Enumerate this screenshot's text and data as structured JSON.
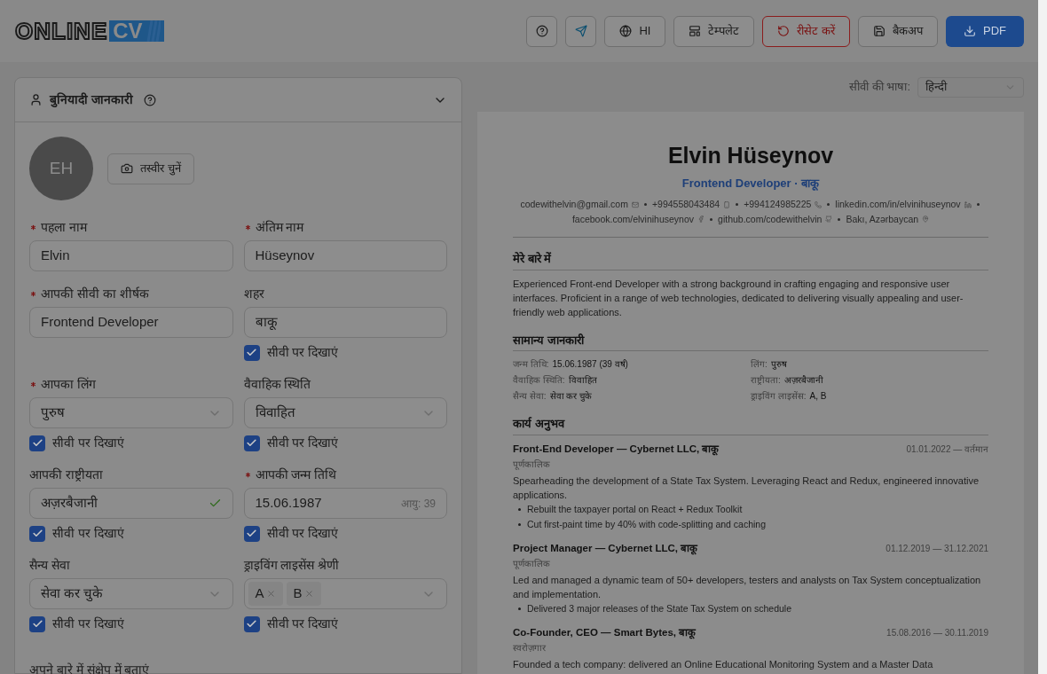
{
  "logo": {
    "word": "ONLINE",
    "mark": "CV"
  },
  "toolbar": [
    {
      "kind": "icon"
    },
    {
      "kind": "icon"
    },
    {
      "kind": "labeled",
      "label": "HI"
    },
    {
      "kind": "labeled",
      "label": "टेम्पलेट"
    },
    {
      "kind": "danger",
      "label": "रीसेट करें"
    },
    {
      "kind": "labeled",
      "label": "बैकअप"
    },
    {
      "kind": "primary",
      "label": "PDF"
    }
  ],
  "section": {
    "title": "बुनियादी जानकारी",
    "expanded": true
  },
  "avatar": {
    "initials": "EH",
    "button": "तस्वीर चुनें"
  },
  "fields": [
    {
      "kind": "input",
      "label": "पहला नाम",
      "required": true,
      "value": "Elvin"
    },
    {
      "kind": "input",
      "label": "अंतिम नाम",
      "required": true,
      "value": "Hüseynov"
    },
    {
      "kind": "input",
      "label": "आपकी सीवी का शीर्षक",
      "required": true,
      "value": "Frontend Developer"
    },
    {
      "kind": "input",
      "label": "शहर",
      "required": false,
      "value": "बाकू",
      "show": {
        "label": "सीवी पर दिखाएं",
        "checked": true
      }
    },
    {
      "kind": "select",
      "label": "आपका लिंग",
      "required": true,
      "value": "पुरुष",
      "show": {
        "label": "सीवी पर दिखाएं",
        "checked": true
      }
    },
    {
      "kind": "select",
      "label": "वैवाहिक स्थिति",
      "required": false,
      "value": "विवाहित",
      "show": {
        "label": "सीवी पर दिखाएं",
        "checked": true
      }
    },
    {
      "kind": "valid",
      "label": "आपकी राष्ट्रीयता",
      "required": false,
      "value": "अज़रबैजानी",
      "show": {
        "label": "सीवी पर दिखाएं",
        "checked": true
      }
    },
    {
      "kind": "date",
      "label": "आपकी जन्म तिथि",
      "required": true,
      "value": "15.06.1987",
      "hint": "आयु: 39",
      "show": {
        "label": "सीवी पर दिखाएं",
        "checked": true
      }
    },
    {
      "kind": "select",
      "label": "सैन्य सेवा",
      "required": false,
      "value": "सेवा कर चुके",
      "show": {
        "label": "सीवी पर दिखाएं",
        "checked": true
      }
    },
    {
      "kind": "multi",
      "label": "ड्राइविंग लाइसेंस श्रेणी",
      "required": false,
      "tags": [
        "A",
        "B"
      ],
      "show": {
        "label": "सीवी पर दिखाएं",
        "checked": true
      }
    }
  ],
  "about_label": "अपने बारे में संक्षेप में बताएं",
  "cv_language": {
    "label": "सीवी की भाषा:",
    "value": "हिन्दी"
  },
  "cv": {
    "name": "Elvin Hüseynov",
    "headline": "Frontend Developer · बाकू",
    "contacts": [
      "codewithelvin@gmail.com",
      "+994558043484",
      "+994124985225",
      "linkedin.com/in/elvinihuseynov",
      "facebook.com/elvinihuseynov",
      "github.com/codewithelvin",
      "Bakı, Azərbaycan"
    ],
    "about_title": "मेरे बारे में",
    "about": "Experienced Front-end Developer with a strong background in crafting engaging and responsive user interfaces. Proficient in a range of web technologies, dedicated to delivering visually appealing and user-friendly web applications.",
    "general_title": "सामान्य जानकारी",
    "general": [
      {
        "label": "जन्म तिथि:",
        "value": "15.06.1987 (39 वर्ष)"
      },
      {
        "label": "लिंग:",
        "value": "पुरुष"
      },
      {
        "label": "वैवाहिक स्थिति:",
        "value": "विवाहित"
      },
      {
        "label": "राष्ट्रीयता:",
        "value": "अज़रबैजानी"
      },
      {
        "label": "सैन्य सेवा:",
        "value": "सेवा कर चुके"
      },
      {
        "label": "ड्राइविंग लाइसेंस:",
        "value": "A, B"
      }
    ],
    "work_title": "कार्य अनुभव",
    "jobs": [
      {
        "title": "Front-End Developer — Cybernet LLC, बाकू",
        "dates": "01.01.2022 — वर्तमान",
        "type": "पूर्णकालिक",
        "summary": "Spearheading the development of a State Tax System. Leveraging React and Redux, engineered innovative applications.",
        "bullets": [
          "Rebuilt the taxpayer portal on React + Redux Toolkit",
          "Cut first-paint time by 40% with code-splitting and caching"
        ]
      },
      {
        "title": "Project Manager — Cybernet LLC, बाकू",
        "dates": "01.12.2019 — 31.12.2021",
        "type": "पूर्णकालिक",
        "summary": "Led and managed a dynamic team of 50+ developers, testers and analysts on Tax System conceptualization and implementation.",
        "bullets": [
          "Delivered 3 major releases of the State Tax System on schedule"
        ]
      },
      {
        "title": "Co-Founder, CEO — Smart Bytes, बाकू",
        "dates": "15.08.2016 — 30.11.2019",
        "type": "स्वरोज़गार",
        "summary": "Founded a tech company: delivered an Online Educational Monitoring System and a Master Data"
      }
    ]
  }
}
